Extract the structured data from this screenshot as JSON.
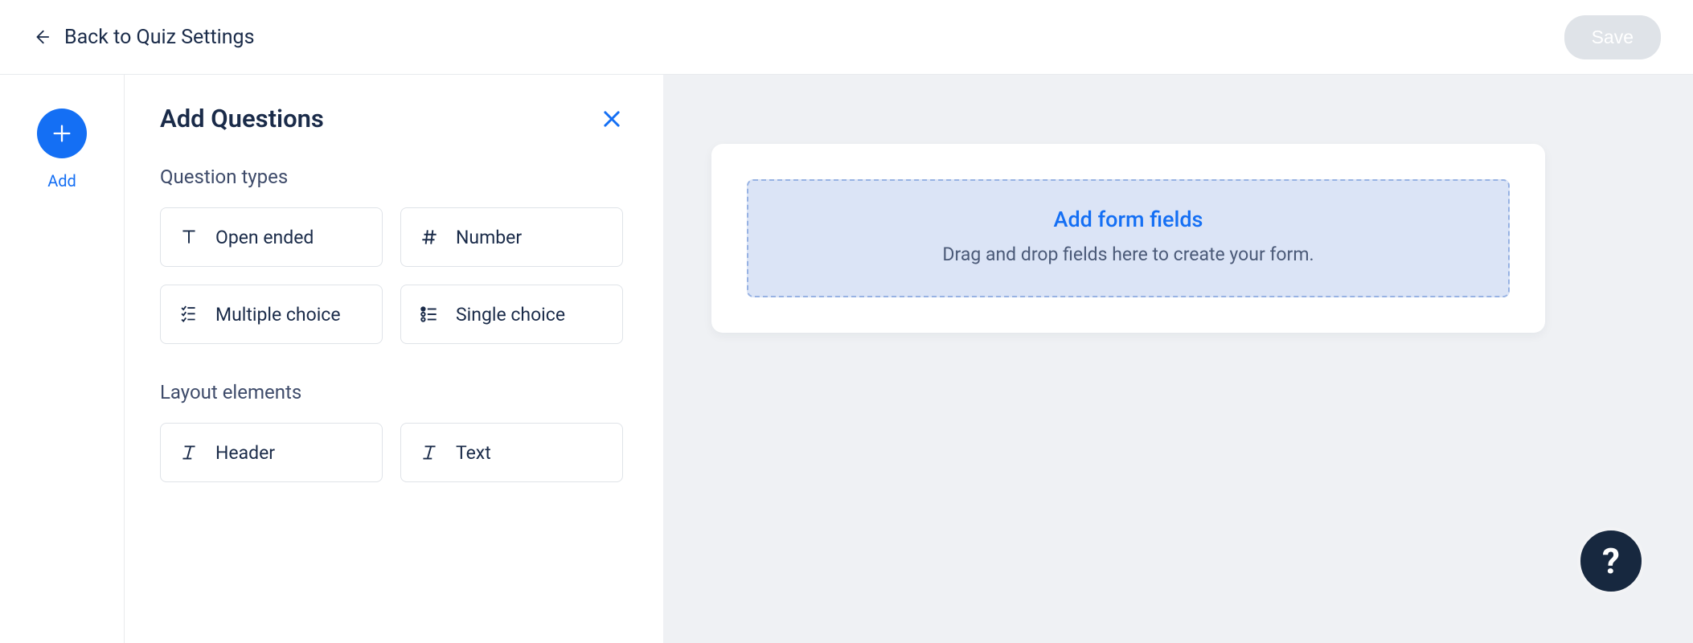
{
  "topbar": {
    "back_label": "Back to Quiz Settings",
    "save_label": "Save"
  },
  "leftnav": {
    "add_label": "Add"
  },
  "panel": {
    "title": "Add Questions",
    "section_question_types": "Question types",
    "section_layout_elements": "Layout elements",
    "types": {
      "open_ended": "Open ended",
      "number": "Number",
      "multiple_choice": "Multiple choice",
      "single_choice": "Single choice"
    },
    "layouts": {
      "header": "Header",
      "text": "Text"
    }
  },
  "canvas": {
    "drop_title": "Add form fields",
    "drop_subtitle": "Drag and drop fields here to create your form."
  },
  "help": {
    "glyph": "?"
  }
}
